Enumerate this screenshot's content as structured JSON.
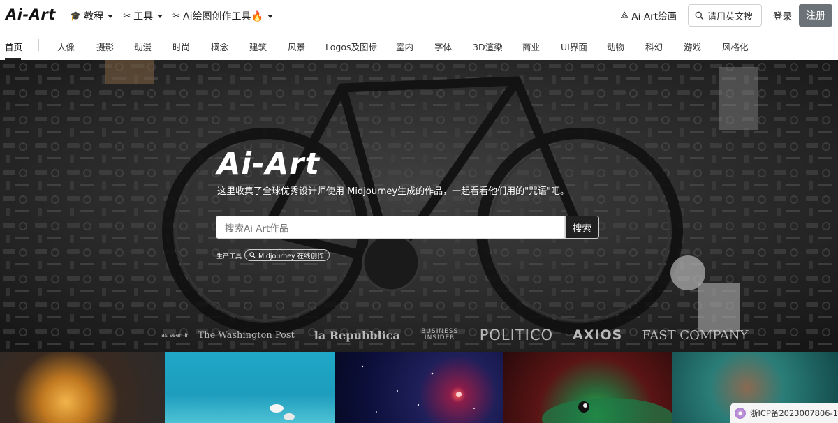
{
  "header": {
    "logo": "Ai-Art",
    "menu": [
      {
        "label": "教程",
        "icon": "graduation-cap-icon"
      },
      {
        "label": "工具",
        "icon": "tools-icon"
      },
      {
        "label": "Ai绘图创作工具🔥",
        "icon": "tools-icon"
      }
    ],
    "drawing_link": "Ai-Art绘画",
    "english_search": "请用英文搜",
    "login": "登录",
    "register": "注册"
  },
  "categories": [
    "首页",
    "人像",
    "摄影",
    "动漫",
    "时尚",
    "概念",
    "建筑",
    "风景",
    "Logos及图标",
    "室内",
    "字体",
    "3D渲染",
    "商业",
    "UI界面",
    "动物",
    "科幻",
    "游戏",
    "风格化"
  ],
  "hero": {
    "title": "Ai-Art",
    "subtitle": "这里收集了全球优秀设计师使用 Midjourney生成的作品，一起看看他们用的\"咒语\"吧。",
    "search_placeholder": "搜索Ai Art作品",
    "search_button": "搜索",
    "tools_label": "生产工具",
    "tool_chip": "Midjourney 在线创作",
    "press": {
      "seen_label": "as seen in",
      "brands": [
        "The Washington Post",
        "la Repubblica",
        "BUSINESS INSIDER",
        "POLITICO",
        "AXIOS",
        "FAST COMPANY"
      ]
    }
  },
  "footer": {
    "icp": "浙ICP备2023007806-1"
  },
  "colors": {
    "register_bg": "#6b7378",
    "search_button_bg": "#212121",
    "hero_bg": "#2f2f2f"
  }
}
